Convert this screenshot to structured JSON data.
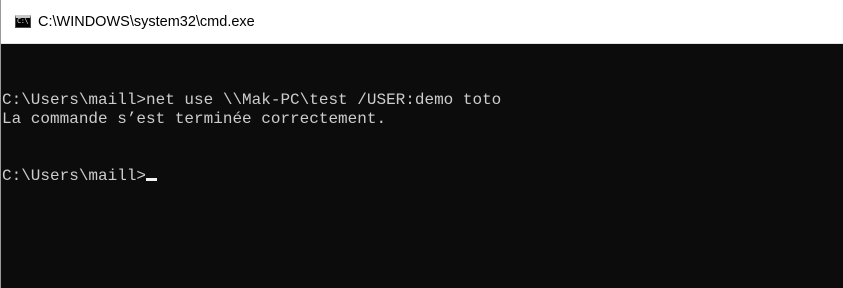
{
  "window": {
    "title": "C:\\WINDOWS\\system32\\cmd.exe",
    "icon": "cmd-console-icon",
    "icon_glyph": "C:\\"
  },
  "console": {
    "lines": [
      "C:\\Users\\maill>net use \\\\Mak-PC\\test /USER:demo toto",
      "La commande s’est terminée correctement.",
      "",
      "",
      "C:\\Users\\maill>"
    ],
    "background_color": "#0c0c0c",
    "text_color": "#cccccc"
  }
}
